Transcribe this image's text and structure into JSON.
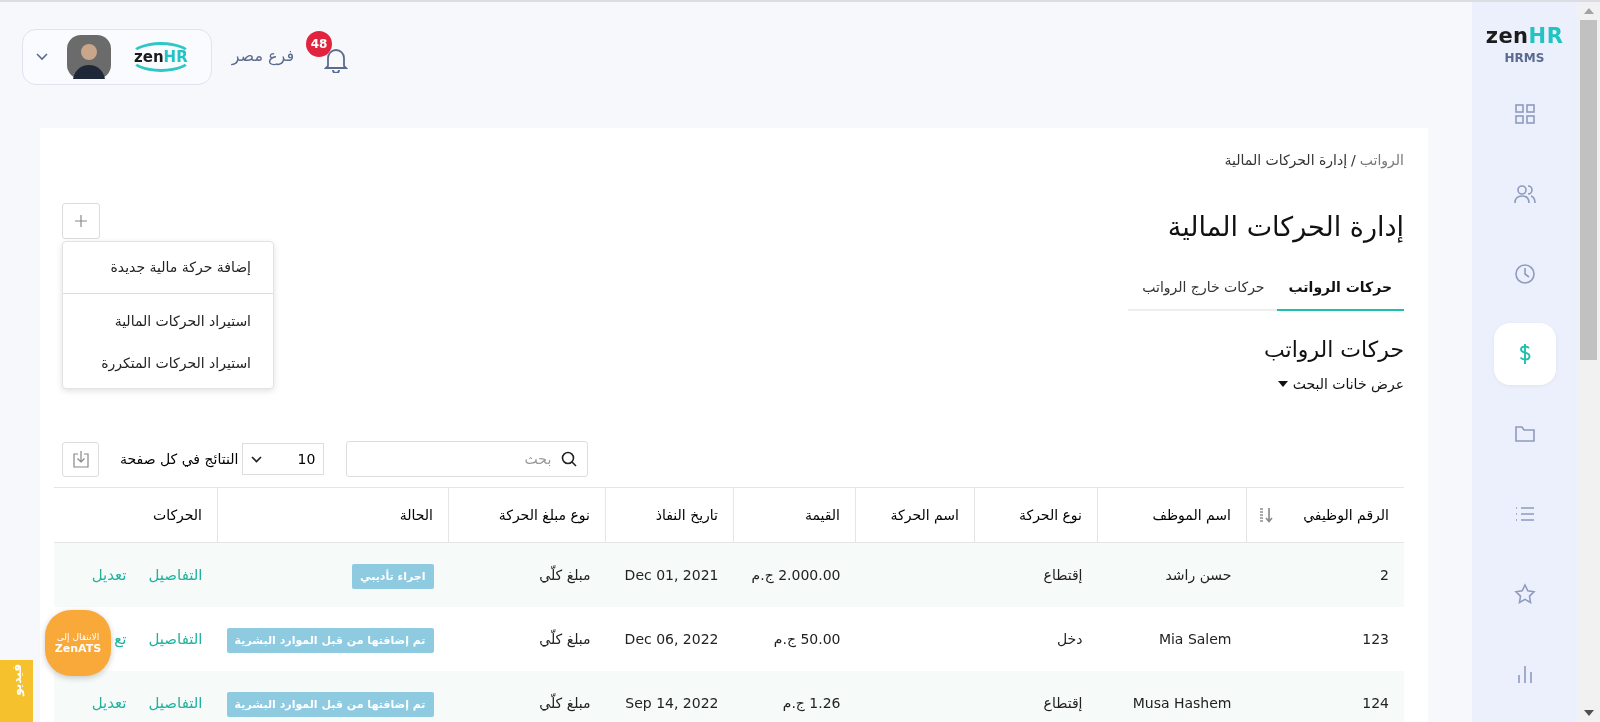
{
  "header": {
    "notifications": "48",
    "branch": "فرع مصر",
    "logo": {
      "zen": "zen",
      "hr": "HR"
    }
  },
  "sidebar": {
    "logo": {
      "zen": "zen",
      "hr": "HR"
    },
    "product": "HRMS",
    "items": [
      {
        "selected": false
      },
      {
        "selected": false
      },
      {
        "selected": false
      },
      {
        "selected": true
      },
      {
        "selected": false
      },
      {
        "selected": false
      },
      {
        "selected": false
      },
      {
        "selected": false
      }
    ]
  },
  "breadcrumb": {
    "parent": "الرواتب",
    "separator": "/",
    "current": "إدارة الحركات المالية"
  },
  "title": "إدارة الحركات المالية",
  "add_menu": {
    "items": [
      "إضافة حركة مالية جديدة",
      "استيراد الحركات المالية",
      "استيراد الحركات المتكررة"
    ]
  },
  "tabs": [
    {
      "label": "حركات الرواتب",
      "selected": true
    },
    {
      "label": "حركات خارج الرواتب",
      "selected": false
    }
  ],
  "section_title": "حركات الرواتب",
  "toggle_search": "عرض خانات البحث",
  "search": {
    "placeholder": "بحث"
  },
  "page_size": {
    "value": "10",
    "label": "النتائج في كل صفحة"
  },
  "table": {
    "columns": [
      "الرقم الوظيفي",
      "اسم الموظف",
      "نوع الحركة",
      "اسم الحركة",
      "القيمة",
      "تاريخ النفاذ",
      "نوع مبلغ الحركة",
      "الحالة",
      "الحركات"
    ],
    "rows": [
      {
        "id": "2",
        "employee": "حسن راشد",
        "type": "إقتطاع",
        "value": "2.000.00 ج.م",
        "date": "Dec 01, 2021",
        "amount_type": "مبلغ كلّي",
        "status": "اجراء تأديبي",
        "actions": [
          "التفاصيل",
          "تعديل"
        ]
      },
      {
        "id": "123",
        "employee": "Mia Salem",
        "type": "دخل",
        "value": "50.00 ج.م",
        "date": "Dec 06, 2022",
        "amount_type": "مبلغ كلّي",
        "status": "تم إضافتها من قبل الموارد البشرية",
        "actions": [
          "التفاصيل",
          "تع"
        ]
      },
      {
        "id": "124",
        "employee": "Musa Hashem",
        "type": "إقتطاع",
        "value": "1.26 ج.م",
        "date": "Sep 14, 2022",
        "amount_type": "مبلغ كلّي",
        "status": "تم إضافتها من قبل الموارد البشرية",
        "actions": [
          "التفاصيل",
          "تعديل"
        ]
      }
    ]
  },
  "floating": {
    "line1": "الانتقال إلى",
    "line2": "ZenATS"
  },
  "side_tab": "فيديو"
}
